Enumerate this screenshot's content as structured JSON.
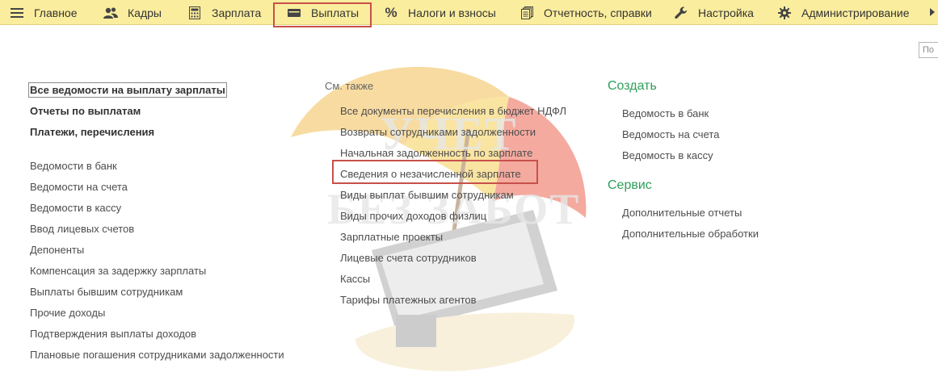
{
  "topbar": {
    "items": [
      {
        "label": "Главное",
        "icon": "hamburger-menu-icon"
      },
      {
        "label": "Кадры",
        "icon": "people-icon"
      },
      {
        "label": "Зарплата",
        "icon": "calculator-icon"
      },
      {
        "label": "Выплаты",
        "icon": "wallet-icon"
      },
      {
        "label": "Налоги и взносы",
        "icon": "percent-icon"
      },
      {
        "label": "Отчетность, справки",
        "icon": "documents-icon"
      },
      {
        "label": "Настройка",
        "icon": "wrench-icon"
      },
      {
        "label": "Администрирование",
        "icon": "gear-icon"
      }
    ],
    "active_item": "Выплаты",
    "scroll_icon": "triangle-right-icon"
  },
  "search": {
    "placeholder": "По"
  },
  "watermark": {
    "line1": "УЧЕТ",
    "line2": "БЕЗ ЗАБОТ"
  },
  "left_column": {
    "main_links": [
      "Все ведомости на выплату зарплаты",
      "Отчеты по выплатам",
      "Платежи, перечисления"
    ],
    "links": [
      "Ведомости в банк",
      "Ведомости на счета",
      "Ведомости в кассу",
      "Ввод лицевых счетов",
      "Депоненты",
      "Компенсация за задержку зарплаты",
      "Выплаты бывшим сотрудникам",
      "Прочие доходы",
      "Подтверждения выплаты доходов",
      "Плановые погашения сотрудниками задолженности"
    ]
  },
  "middle_column": {
    "caption": "См. также",
    "links": [
      "Все документы перечисления в бюджет НДФЛ",
      "Возвраты сотрудниками задолженности",
      "Начальная задолженность по зарплате",
      "Сведения о незачисленной зарплате",
      "Виды выплат бывшим сотрудникам",
      "Виды прочих доходов физлиц",
      "Зарплатные проекты",
      "Лицевые счета сотрудников",
      "Кассы",
      "Тарифы платежных агентов"
    ],
    "highlighted_link": "Сведения о незачисленной зарплате"
  },
  "right_column": {
    "create_title": "Создать",
    "create_links": [
      "Ведомость в банк",
      "Ведомость на счета",
      "Ведомость в кассу"
    ],
    "service_title": "Сервис",
    "service_links": [
      "Дополнительные отчеты",
      "Дополнительные обработки"
    ]
  },
  "colors": {
    "topbar_bg": "#fbed9e",
    "highlight_frame": "#c8504a",
    "section_title": "#2e9e5a",
    "link_text": "#4d4d4d"
  }
}
